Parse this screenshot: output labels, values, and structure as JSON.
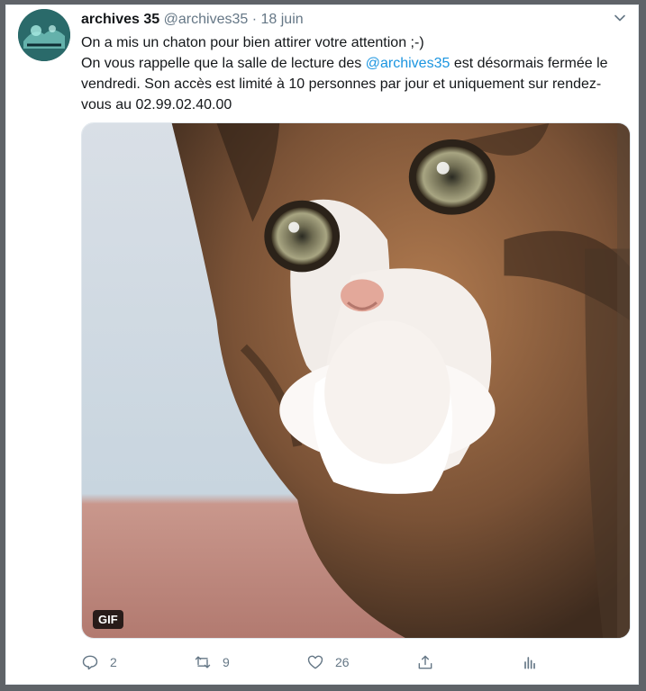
{
  "tweet": {
    "display_name": "archives 35",
    "handle": "@archives35",
    "separator": "·",
    "date": "18 juin",
    "line1": "On a mis un chaton pour bien attirer votre attention ;-)",
    "line2_pre": "On vous rappelle que la salle de lecture des ",
    "mention": "@archives35",
    "line2_post": " est désormais fermée le vendredi. Son accès est limité à 10 personnes par jour et uniquement sur rendez-vous au 02.99.02.40.00",
    "media_badge": "GIF"
  },
  "actions": {
    "reply_count": "2",
    "retweet_count": "9",
    "like_count": "26"
  },
  "icons": {
    "reply": "reply-icon",
    "retweet": "retweet-icon",
    "like": "heart-icon",
    "share": "share-icon",
    "analytics": "analytics-icon",
    "menu": "chevron-down-icon"
  },
  "colors": {
    "text": "#14171a",
    "muted": "#657786",
    "link": "#1b95e0",
    "frame": "#5f6368"
  }
}
